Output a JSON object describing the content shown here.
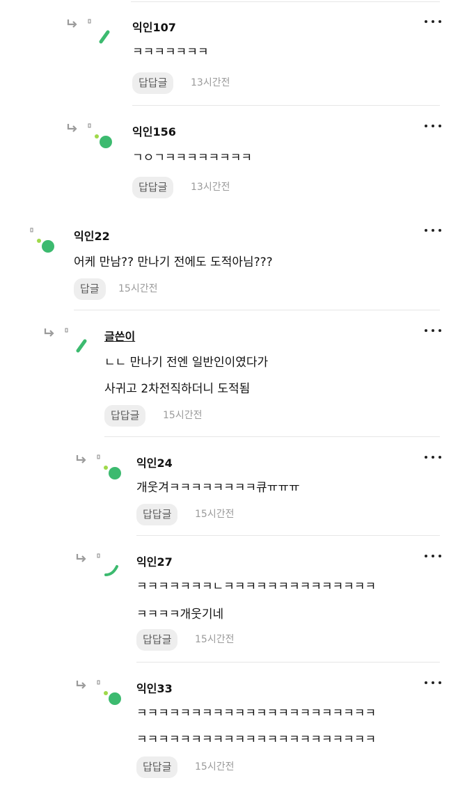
{
  "comments": [
    {
      "author": "익인107",
      "lines": [
        "ㅋㅋㅋㅋㅋㅋㅋ"
      ],
      "reply_label": "답답글",
      "time": "13시간전",
      "avatar": "stroke",
      "is_op": false
    },
    {
      "author": "익인156",
      "lines": [
        "ㄱㅇㄱㅋㅋㅋㅋㅋㅋㅋㅋ"
      ],
      "reply_label": "답답글",
      "time": "13시간전",
      "avatar": "dots",
      "is_op": false
    },
    {
      "author": "익인22",
      "lines": [
        "어케 만남?? 만나기 전에도 도적아님???"
      ],
      "reply_label": "답글",
      "time": "15시간전",
      "avatar": "dots",
      "is_op": false
    },
    {
      "author": "글쓴이",
      "lines": [
        "ㄴㄴ 만나기 전엔 일반인이였다가",
        "사귀고 2차전직하더니 도적됨"
      ],
      "reply_label": "답답글",
      "time": "15시간전",
      "avatar": "stroke",
      "is_op": true
    },
    {
      "author": "익인24",
      "lines": [
        "개웃겨ㅋㅋㅋㅋㅋㅋㅋㅋ큐ㅠㅠㅠ"
      ],
      "reply_label": "답답글",
      "time": "15시간전",
      "avatar": "dots",
      "is_op": false
    },
    {
      "author": "익인27",
      "lines": [
        "ㅋㅋㅋㅋㅋㅋㅋㄴㅋㅋㅋㅋㅋㅋㅋㅋㅋㅋㅋㅋㅋㅋ",
        "ㅋㅋㅋㅋ개웃기네"
      ],
      "reply_label": "답답글",
      "time": "15시간전",
      "avatar": "curve",
      "is_op": false
    },
    {
      "author": "익인33",
      "lines": [
        "ㅋㅋㅋㅋㅋㅋㅋㅋㅋㅋㅋㅋㅋㅋㅋㅋㅋㅋㅋㅋㅋㅋ",
        "ㅋㅋㅋㅋㅋㅋㅋㅋㅋㅋㅋㅋㅋㅋㅋㅋㅋㅋㅋㅋㅋㅋ"
      ],
      "reply_label": "답답글",
      "time": "15시간전",
      "avatar": "dots",
      "is_op": false
    }
  ],
  "colors": {
    "avatar_green": "#3cba6f",
    "avatar_light_green": "#9fd94a",
    "text": "#111111",
    "muted": "#9a9a9a",
    "button_bg": "#eeeeee"
  },
  "icons": {
    "reply": "reply-arrow-icon",
    "more": "more-options-icon"
  }
}
